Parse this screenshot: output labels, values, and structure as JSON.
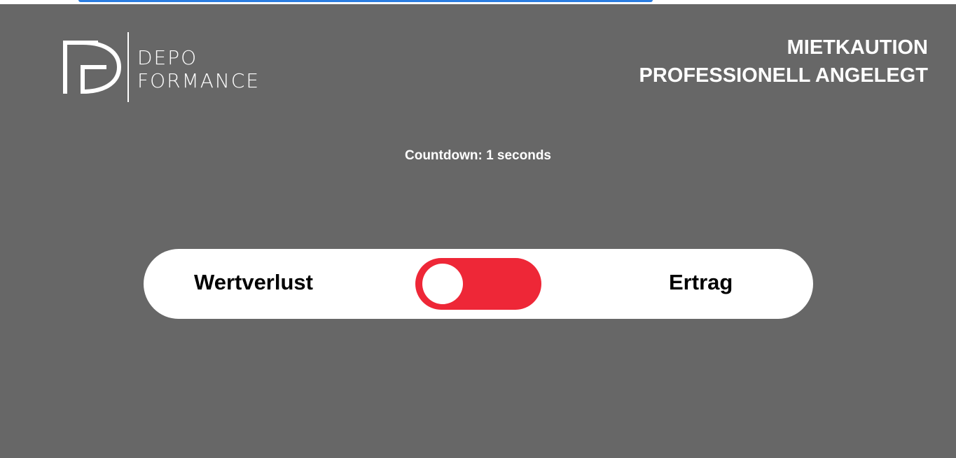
{
  "brand": {
    "logo_line1": "DEPO",
    "logo_line2": "FORMANCE",
    "logo_icon": "df-monogram-icon"
  },
  "header": {
    "tagline_line1": "MIETKAUTION",
    "tagline_line2": "PROFESSIONELL ANGELEGT"
  },
  "countdown": {
    "text": "Countdown: 1 seconds"
  },
  "switcher": {
    "left_label": "Wertverlust",
    "right_label": "Ertrag",
    "state": "left",
    "active_color": "#ee2737"
  },
  "colors": {
    "background": "#676767",
    "accent": "#2a7de1",
    "toggle": "#ee2737"
  }
}
